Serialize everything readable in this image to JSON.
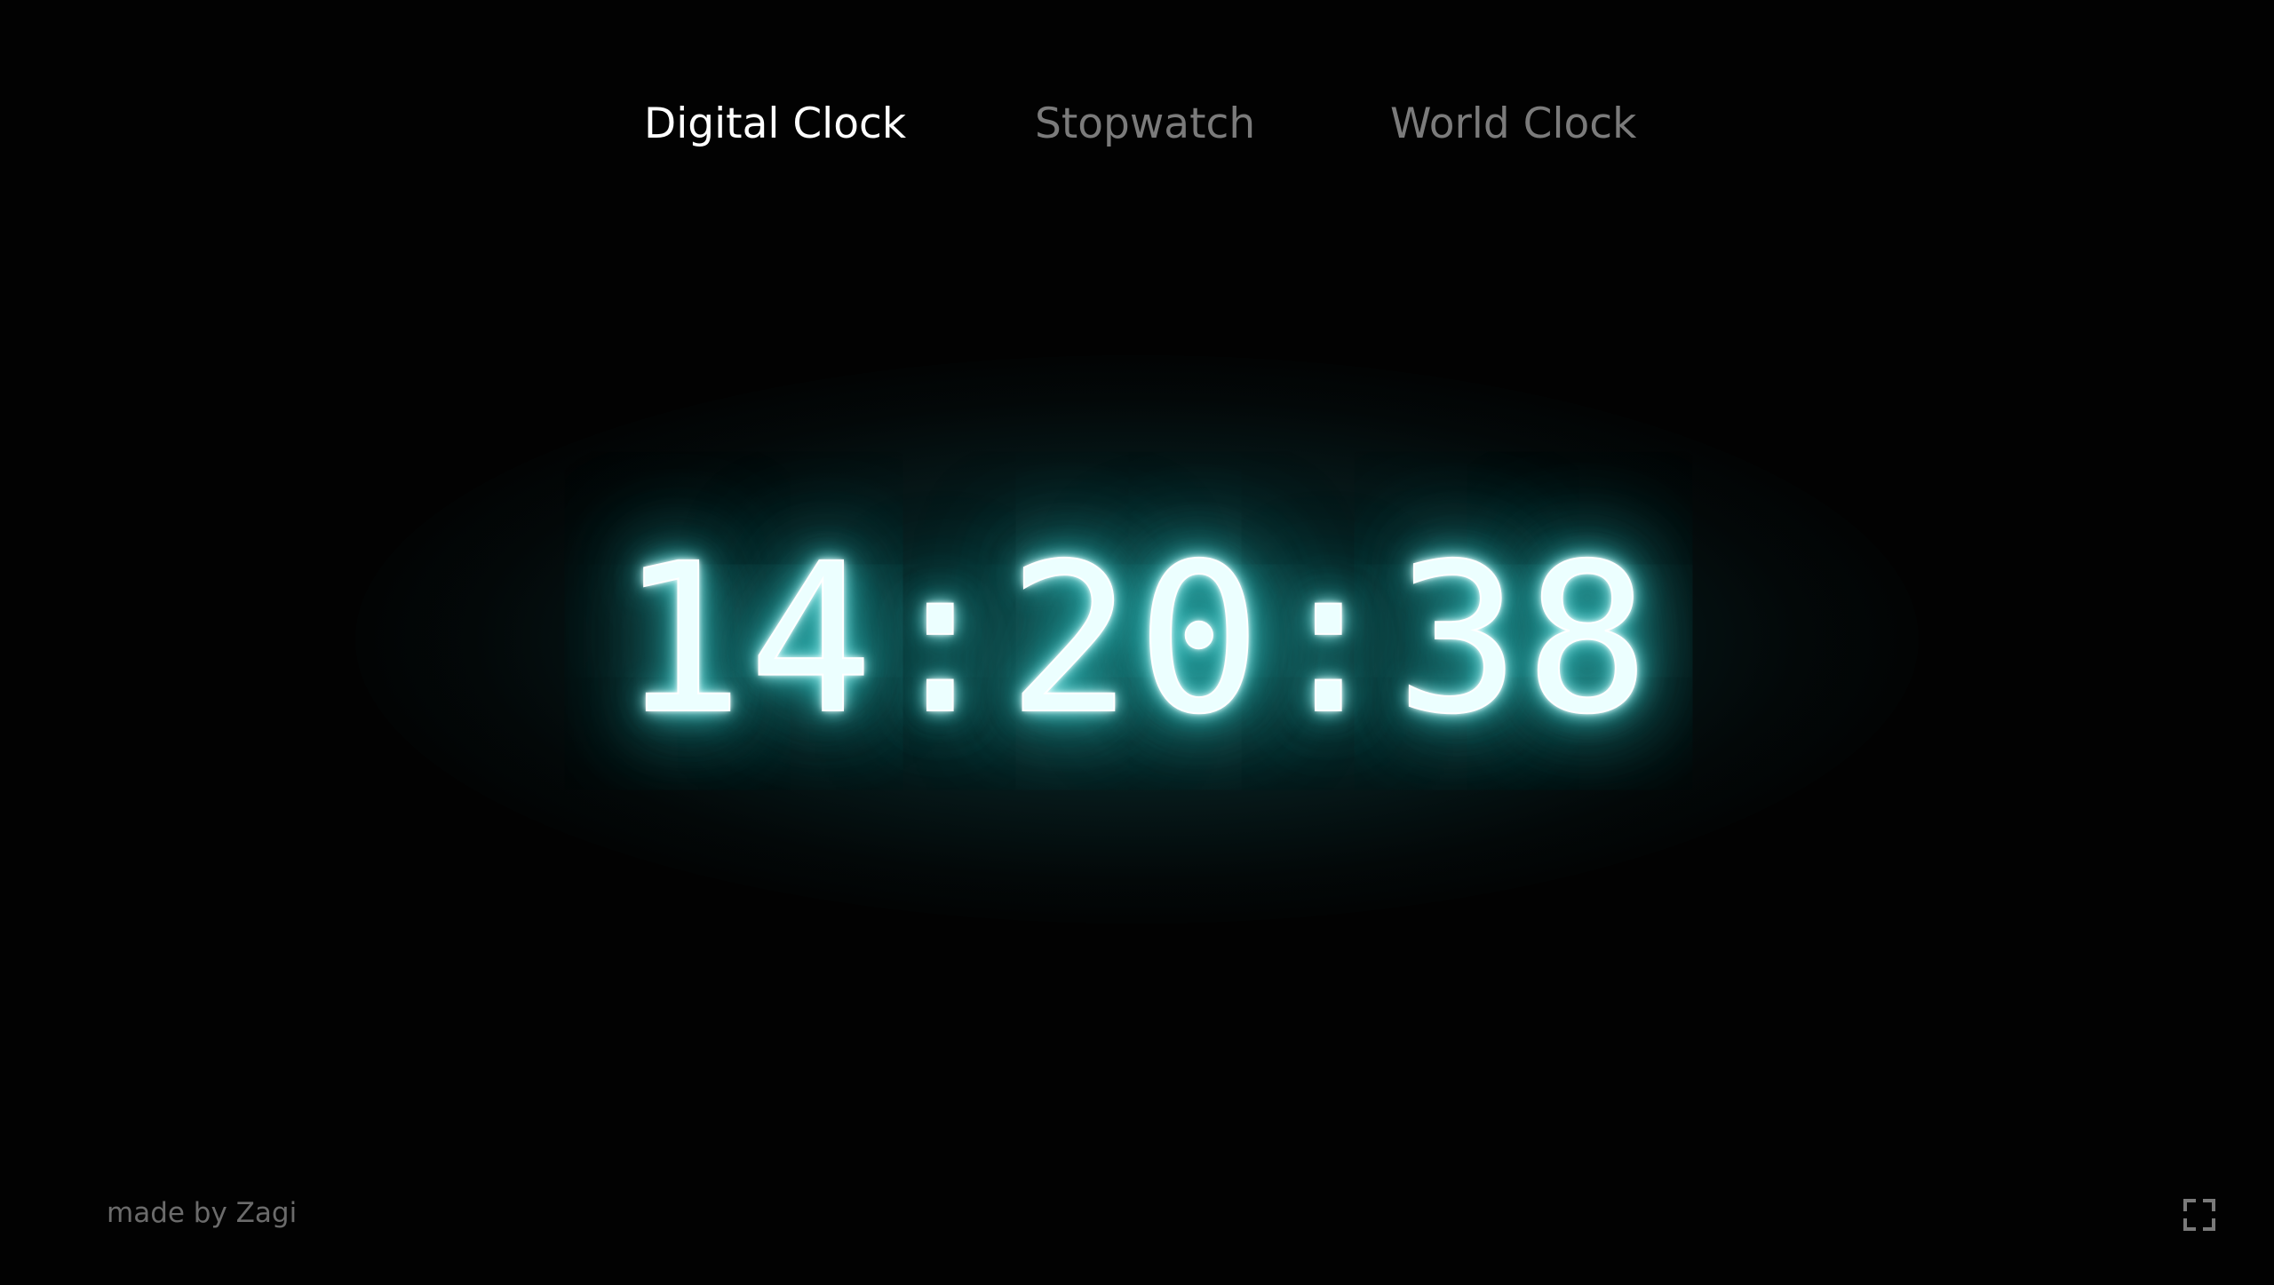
{
  "nav": {
    "tabs": [
      {
        "label": "Digital Clock",
        "active": true
      },
      {
        "label": "Stopwatch",
        "active": false
      },
      {
        "label": "World Clock",
        "active": false
      }
    ]
  },
  "clock": {
    "time": "14:20:38",
    "glow_color": "#2bb8b8",
    "text_color": "#ecffff"
  },
  "footer": {
    "credit": "made by Zagi",
    "fullscreen_icon": "fullscreen-icon"
  },
  "colors": {
    "background": "#020202",
    "tab_active": "#ffffff",
    "tab_inactive": "#7b7b7b",
    "credit": "#6b6b6b"
  }
}
